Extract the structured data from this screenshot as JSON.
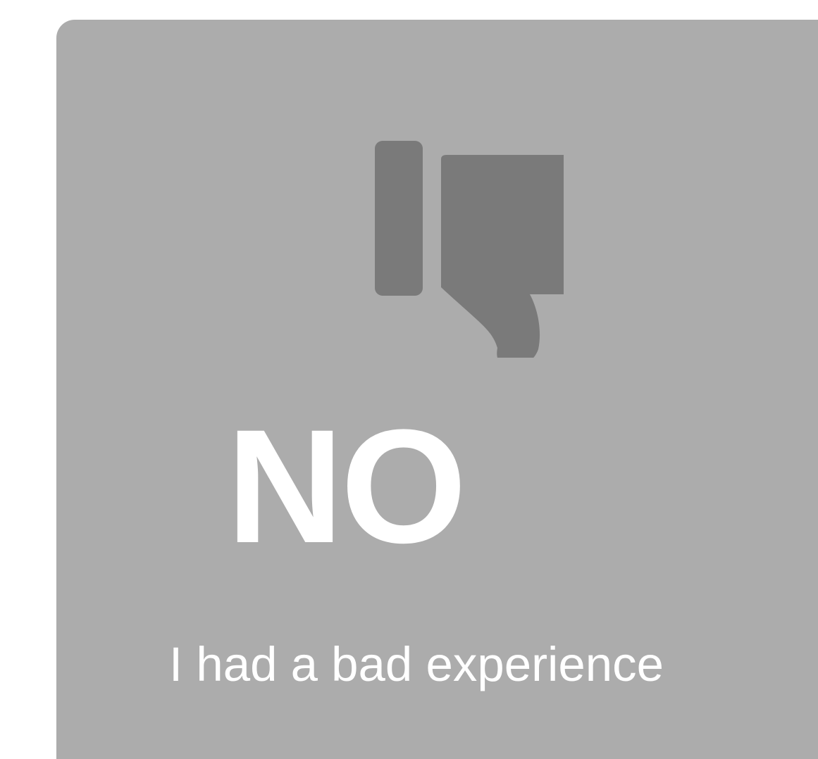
{
  "feedback_card": {
    "title": "NO",
    "subtitle": "I had a bad experience",
    "icon": "thumbs-down-icon",
    "colors": {
      "card_background": "#acacac",
      "icon": "#7a7a7a",
      "text": "#ffffff"
    }
  }
}
